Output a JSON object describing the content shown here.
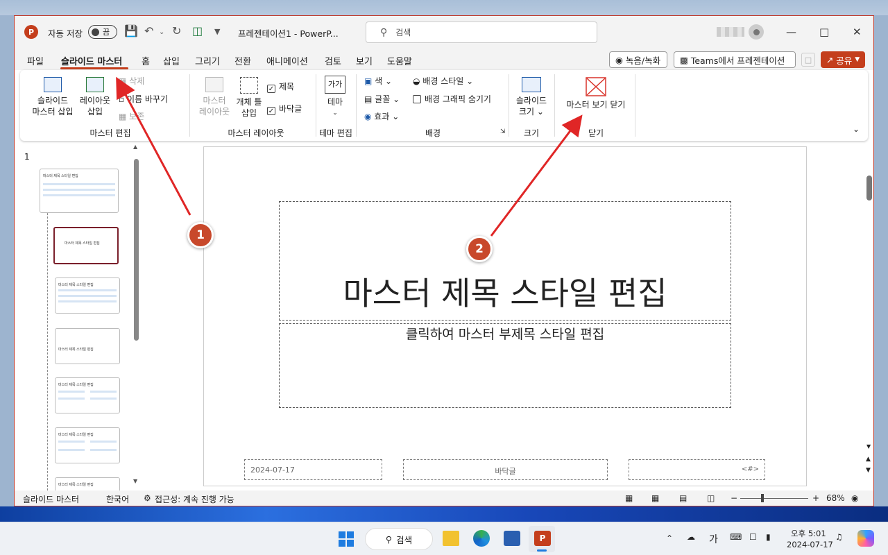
{
  "titlebar": {
    "autosave_label": "자동 저장",
    "autosave_state": "끔",
    "doc_title": "프레젠테이션1  -  PowerP...",
    "search_placeholder": "검색"
  },
  "menu": {
    "items": [
      "파일",
      "슬라이드 마스터",
      "홈",
      "삽입",
      "그리기",
      "전환",
      "애니메이션",
      "검토",
      "보기",
      "도움말"
    ],
    "active_index": 1,
    "record_label": "녹음/녹화",
    "teams_label": "Teams에서 프레젠테이션",
    "share_label": "공유"
  },
  "ribbon": {
    "insert_master": "슬라이드\n마스터 삽입",
    "insert_layout": "레이아웃\n삽입",
    "delete": "삭제",
    "rename": "이름 바꾸기",
    "preserve": "보존",
    "group_master_edit": "마스터 편집",
    "master_layout": "마스터\n레이아웃",
    "insert_placeholder": "개체 틀\n삽입",
    "title_check": "제목",
    "footer_check": "바닥글",
    "group_master_layout": "마스터 레이아웃",
    "theme_icon": "가가",
    "theme": "테마",
    "group_theme_edit": "테마 편집",
    "colors": "색",
    "fonts": "글꼴",
    "effects": "효과",
    "bg_styles": "배경 스타일",
    "hide_bg_graphics": "배경 그래픽 숨기기",
    "group_background": "배경",
    "slide_size": "슬라이드\n크기",
    "group_size": "크기",
    "close_master": "마스터 보기 닫기",
    "group_close": "닫기"
  },
  "thumbnails": {
    "slide_number": "1",
    "title_text": "마스터 제목 스타일 편집"
  },
  "slide": {
    "title": "마스터 제목 스타일 편집",
    "subtitle": "클릭하여 마스터 부제목 스타일 편집",
    "date": "2024-07-17",
    "footer": "바닥글",
    "page_number": "<#>"
  },
  "status": {
    "view": "슬라이드 마스터",
    "language": "한국어",
    "accessibility": "접근성: 계속 진행 가능",
    "zoom": "68%"
  },
  "taskbar": {
    "search": "검색",
    "ime": "가",
    "time": "오후 5:01",
    "date": "2024-07-17"
  },
  "annotations": {
    "marker_1": "1",
    "marker_2": "2"
  },
  "colors": {
    "accent": "#c43e1c",
    "arrow": "#e02626",
    "marker": "#c8482b"
  }
}
